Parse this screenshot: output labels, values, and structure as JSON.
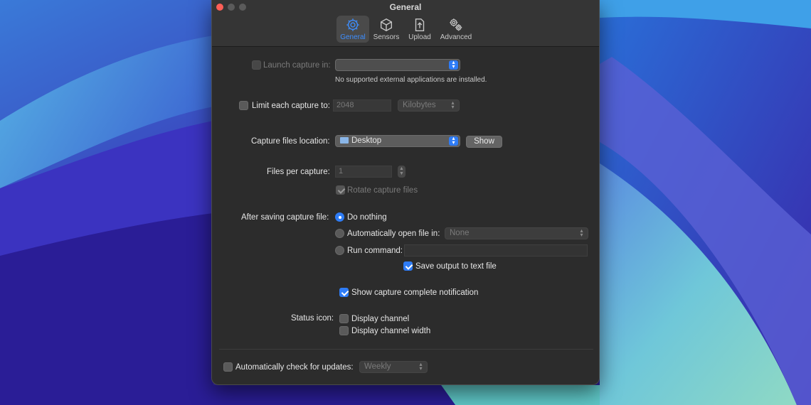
{
  "window": {
    "title": "General"
  },
  "toolbar": {
    "items": [
      {
        "label": "General",
        "icon": "gear-icon",
        "active": true
      },
      {
        "label": "Sensors",
        "icon": "cube-icon",
        "active": false
      },
      {
        "label": "Upload",
        "icon": "upload-icon",
        "active": false
      },
      {
        "label": "Advanced",
        "icon": "gears-icon",
        "active": false
      }
    ]
  },
  "settings": {
    "launch_capture_label": "Launch capture in:",
    "launch_capture_note": "No supported external applications are installed.",
    "limit_capture_label": "Limit each capture to:",
    "limit_capture_value": "2048",
    "limit_capture_unit": "Kilobytes",
    "location_label": "Capture files location:",
    "location_value": "Desktop",
    "show_button": "Show",
    "files_per_capture_label": "Files per capture:",
    "files_per_capture_value": "1",
    "rotate_label": "Rotate capture files",
    "after_saving_label": "After saving capture file:",
    "do_nothing_label": "Do nothing",
    "auto_open_label": "Automatically open file in:",
    "auto_open_value": "None",
    "run_command_label": "Run command:",
    "save_output_label": "Save output to text file",
    "show_notification_label": "Show capture complete notification",
    "status_icon_label": "Status icon:",
    "display_channel_label": "Display channel",
    "display_channel_width_label": "Display channel width",
    "updates_label": "Automatically check for updates:",
    "updates_value": "Weekly"
  },
  "colors": {
    "accent": "#2e7cf6",
    "window_bg": "#2c2c2c",
    "close": "#fe5f57"
  }
}
